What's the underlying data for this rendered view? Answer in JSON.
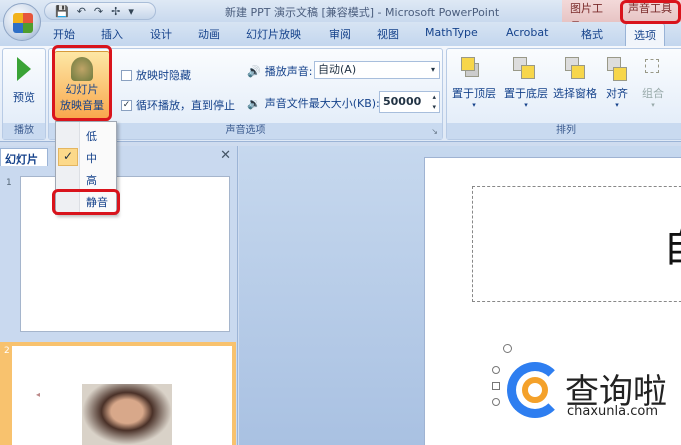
{
  "window": {
    "title": "新建 PPT 演示文稿 [兼容模式] - Microsoft PowerPoint",
    "contextual_tabs": [
      "图片工具",
      "声音工具"
    ]
  },
  "tabs": [
    "开始",
    "插入",
    "设计",
    "动画",
    "幻灯片放映",
    "审阅",
    "视图",
    "MathType",
    "Acrobat",
    "格式",
    "选项"
  ],
  "ribbon": {
    "play_group": {
      "preview": "预览",
      "label": "播放"
    },
    "volume_button": {
      "line1": "幻灯片",
      "line2": "放映音量"
    },
    "sound_group": {
      "hide_during_show": "放映时隐藏",
      "hide_checked": false,
      "loop": "循环播放，直到停止",
      "loop_checked": true,
      "play_sound_label": "播放声音:",
      "play_sound_value": "自动(A)",
      "max_size_label": "声音文件最大大小(KB):",
      "max_size_value": "50000",
      "label": "声音选项"
    },
    "arrange_group": {
      "bring_front": "置于顶层",
      "send_back": "置于底层",
      "selection_pane": "选择窗格",
      "align": "对齐",
      "group": "组合",
      "label": "排列"
    }
  },
  "volume_menu": {
    "items": [
      "低",
      "中",
      "高",
      "静音"
    ],
    "selected": "中",
    "highlighted": "静音"
  },
  "slides_pane": {
    "tab": "幻灯片",
    "close": "✕",
    "slide_numbers": [
      "1",
      "2"
    ]
  },
  "slide": {
    "title_fragment": "自"
  },
  "watermark": {
    "text": "查询啦",
    "url": "chaxunla.com"
  },
  "colors": {
    "accent_red": "#d9141c",
    "ribbon_blue": "#15428b"
  }
}
